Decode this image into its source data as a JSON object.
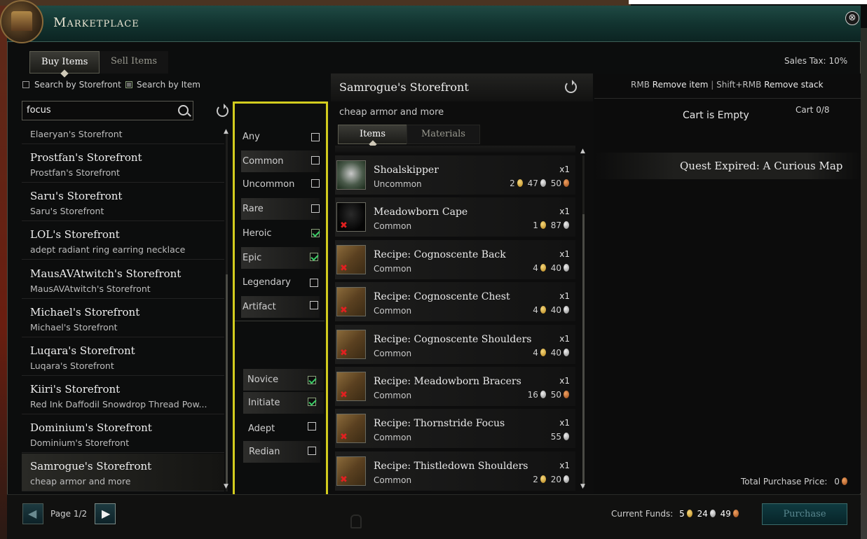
{
  "window": {
    "title": "Marketplace",
    "close_glyph": "⊗"
  },
  "tabs": {
    "buy": "Buy Items",
    "sell": "Sell Items"
  },
  "sales_tax": {
    "label": "Sales Tax:",
    "value": "10%"
  },
  "search_mode": {
    "by_storefront": "Search by Storefront",
    "by_item": "Search by Item",
    "by_storefront_checked": false,
    "by_item_checked": true
  },
  "search": {
    "value": "focus"
  },
  "storefronts": [
    {
      "name": "",
      "sub": "Elaeryan's Storefront"
    },
    {
      "name": "Prostfan's Storefront",
      "sub": "Prostfan's Storefront"
    },
    {
      "name": "Saru's Storefront",
      "sub": "Saru's Storefront"
    },
    {
      "name": "LOL's Storefront",
      "sub": "adept radiant ring earring necklace"
    },
    {
      "name": "MausAVAtwitch's Storefront",
      "sub": "MausAVAtwitch's Storefront"
    },
    {
      "name": "Michael's Storefront",
      "sub": "Michael's Storefront"
    },
    {
      "name": "Luqara's Storefront",
      "sub": "Luqara's Storefront"
    },
    {
      "name": "Kiiri's Storefront",
      "sub": "Red Ink Daffodil Snowdrop Thread Pow..."
    },
    {
      "name": "Dominium's Storefront",
      "sub": "Dominium's Storefront"
    },
    {
      "name": "Samrogue's Storefront",
      "sub": "cheap armor and more",
      "selected": true
    }
  ],
  "rarity_filters": [
    {
      "label": "Any",
      "checked": false
    },
    {
      "label": "Common",
      "checked": false
    },
    {
      "label": "Uncommon",
      "checked": false
    },
    {
      "label": "Rare",
      "checked": false
    },
    {
      "label": "Heroic",
      "checked": true
    },
    {
      "label": "Epic",
      "checked": true
    },
    {
      "label": "Legendary",
      "checked": false
    },
    {
      "label": "Artifact",
      "checked": false
    }
  ],
  "tier_filters": [
    {
      "label": "Novice",
      "checked": true
    },
    {
      "label": "Initiate",
      "checked": true
    },
    {
      "label": "Adept",
      "checked": false
    },
    {
      "label": "Redian",
      "checked": false
    }
  ],
  "storefront": {
    "name": "Samrogue's Storefront",
    "description": "cheap armor and more",
    "tabs": [
      "Items",
      "Materials"
    ]
  },
  "items": [
    {
      "name": "Shoalskipper",
      "rarity": "Uncommon",
      "qty": "x1",
      "gold": "2",
      "silver": "47",
      "copper": "50",
      "icon": "creature-icon",
      "unusable": false
    },
    {
      "name": "Meadowborn Cape",
      "rarity": "Common",
      "qty": "x1",
      "gold": "1",
      "silver": "87",
      "copper": "",
      "icon": "cape-icon",
      "unusable": true
    },
    {
      "name": "Recipe: Cognoscente Back",
      "rarity": "Common",
      "qty": "x1",
      "gold": "4",
      "silver": "40",
      "copper": "",
      "icon": "recipe-scroll-icon",
      "unusable": true
    },
    {
      "name": "Recipe: Cognoscente Chest",
      "rarity": "Common",
      "qty": "x1",
      "gold": "4",
      "silver": "40",
      "copper": "",
      "icon": "recipe-scroll-icon",
      "unusable": true
    },
    {
      "name": "Recipe: Cognoscente Shoulders",
      "rarity": "Common",
      "qty": "x1",
      "gold": "4",
      "silver": "40",
      "copper": "",
      "icon": "recipe-scroll-icon",
      "unusable": true
    },
    {
      "name": "Recipe: Meadowborn Bracers",
      "rarity": "Common",
      "qty": "x1",
      "gold": "",
      "silver": "16",
      "copper": "50",
      "icon": "recipe-scroll-icon",
      "unusable": true
    },
    {
      "name": "Recipe: Thornstride Focus",
      "rarity": "Common",
      "qty": "x1",
      "gold": "",
      "silver": "55",
      "copper": "",
      "icon": "recipe-scroll-icon",
      "unusable": true
    },
    {
      "name": "Recipe: Thistledown Shoulders",
      "rarity": "Common",
      "qty": "x1",
      "gold": "2",
      "silver": "20",
      "copper": "",
      "icon": "recipe-scroll-icon",
      "unusable": true
    }
  ],
  "cart": {
    "hint_rmb": "RMB",
    "hint_remove_item": "Remove item",
    "hint_sep": "|",
    "hint_shift_rmb": "Shift+RMB",
    "hint_remove_stack": "Remove stack",
    "empty_text": "Cart is Empty",
    "count_label": "Cart",
    "count": "0/8",
    "quest_banner": "Quest Expired: A Curious Map",
    "total_label": "Total Purchase Price:",
    "total": "0"
  },
  "pager": {
    "label": "Page 1/2"
  },
  "funds": {
    "label": "Current Funds:",
    "gold": "5",
    "silver": "24",
    "copper": "49"
  },
  "purchase_label": "Purchase",
  "colors": {
    "accent_teal": "#1f4a44",
    "highlight_box": "#d2cc1e",
    "check_green": "#3cd068",
    "unusable_red": "#e02020"
  }
}
